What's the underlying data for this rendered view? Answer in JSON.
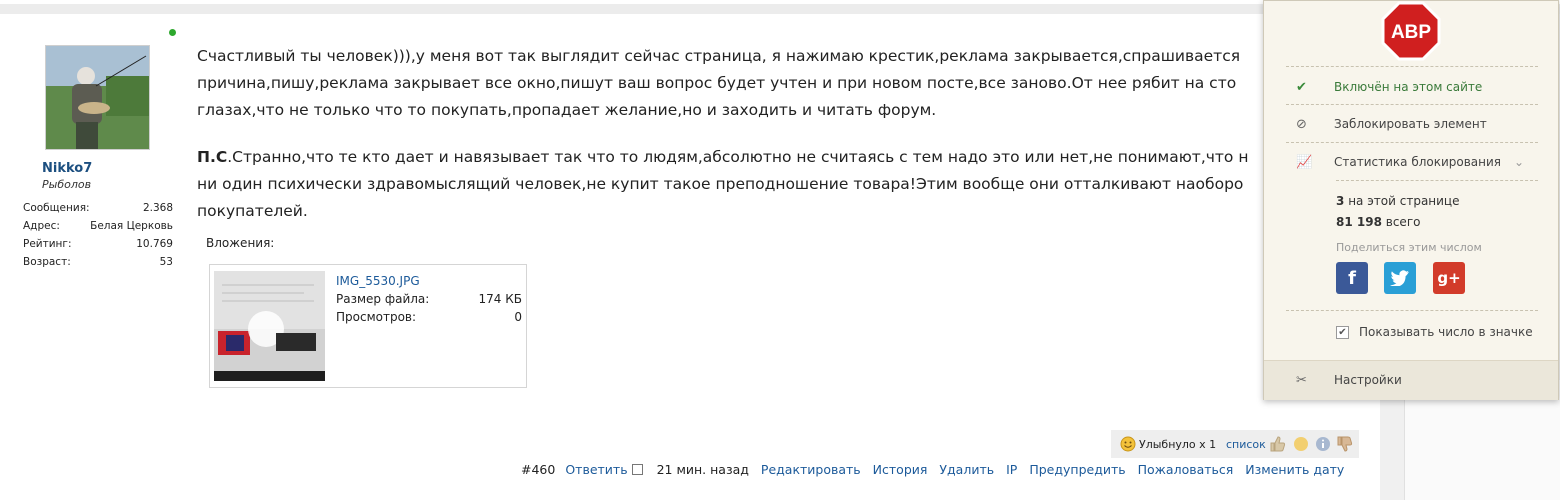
{
  "user": {
    "name": "Nikko7",
    "title": "Рыболов",
    "stats": [
      {
        "label": "Сообщения:",
        "value": "2.368"
      },
      {
        "label": "Адрес:",
        "value": "Белая Церковь"
      },
      {
        "label": "Рейтинг:",
        "value": "10.769"
      },
      {
        "label": "Возраст:",
        "value": "53"
      }
    ]
  },
  "post": {
    "line1": "Счастливый ты человек))),у меня вот так выглядит сейчас страница, я нажимаю крестик,реклама закрывается,спрашивается",
    "line2": "причина,пишу,реклама закрывает все окно,пишут ваш вопрос будет учтен и при новом посте,все заново.От нее рябит на сто",
    "line3": "глазах,что не только что то покупать,пропадает желание,но и заходить и читать форум.",
    "p2_bold": "П.С",
    "p2_line1": ".Странно,что те кто дает и навязывает так что то людям,абсолютно не считаясь с тем надо это или нет,не понимают,что н",
    "p2_line2": "ни один психически здравомыслящий человек,не купит такое преподношение товара!Этим вообще они отталкивают наоборо",
    "p2_line3": "покупателей."
  },
  "attachments": {
    "label": "Вложения:",
    "file_name": "IMG_5530.JPG",
    "size_label": "Размер файла:",
    "size_value": "174 КБ",
    "views_label": "Просмотров:",
    "views_value": "0"
  },
  "reactions": {
    "text": "Улыбнуло x 1",
    "list_link": "список"
  },
  "postbar": {
    "number": "#460",
    "reply": "Ответить",
    "time": "21 мин. назад",
    "edit": "Редактировать",
    "history": "История",
    "delete": "Удалить",
    "ip": "IP",
    "warn": "Предупредить",
    "report": "Пожаловаться",
    "change_date": "Изменить дату"
  },
  "abp": {
    "logo_text": "ABP",
    "enabled": "Включён на этом сайте",
    "block_element": "Заблокировать элемент",
    "stats_title": "Статистика блокирования",
    "page_count": "3",
    "page_count_label": "на этой странице",
    "total_count": "81 198",
    "total_label": "всего",
    "share_label": "Поделиться этим числом",
    "facebook": "f",
    "google": "g+",
    "show_count": "Показывать число в значке",
    "settings": "Настройки",
    "colors": {
      "logo_red": "#d01f1f",
      "facebook": "#3b5998",
      "twitter": "#2a9fd6",
      "google": "#d23b2a",
      "check": "#3a8a3a"
    }
  }
}
